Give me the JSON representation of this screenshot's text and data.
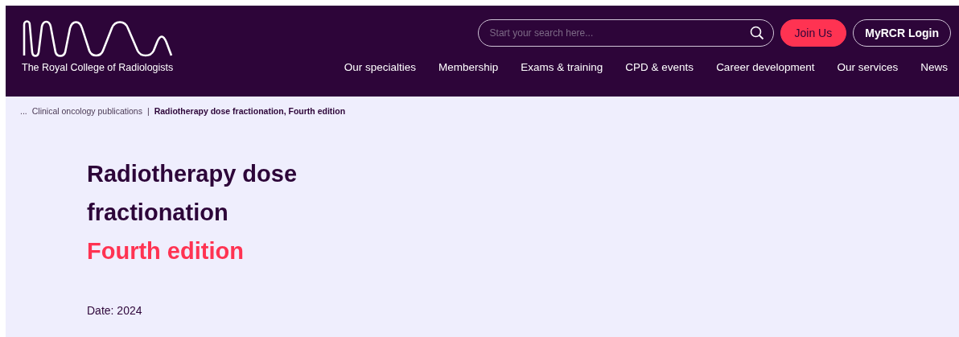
{
  "header": {
    "logo_text": "The Royal College of Radiologists",
    "search": {
      "placeholder": "Start your search here..."
    },
    "buttons": [
      {
        "label": "Join Us",
        "kind": "primary"
      },
      {
        "label": "MyRCR Login",
        "kind": "outline"
      }
    ],
    "nav": [
      "Our specialties",
      "Membership",
      "Exams & training",
      "CPD & events",
      "Career development",
      "Our services",
      "News"
    ]
  },
  "breadcrumb": {
    "ellipsis": "...",
    "items": [
      {
        "label": "Clinical oncology publications",
        "current": false
      },
      {
        "label": "Radiotherapy dose fractionation, Fourth edition",
        "current": true
      }
    ],
    "separator": "|"
  },
  "title": {
    "lines": [
      "Radiotherapy dose",
      "fractionation"
    ],
    "subtitle": "Fourth edition"
  },
  "date": "Date: 2024"
}
